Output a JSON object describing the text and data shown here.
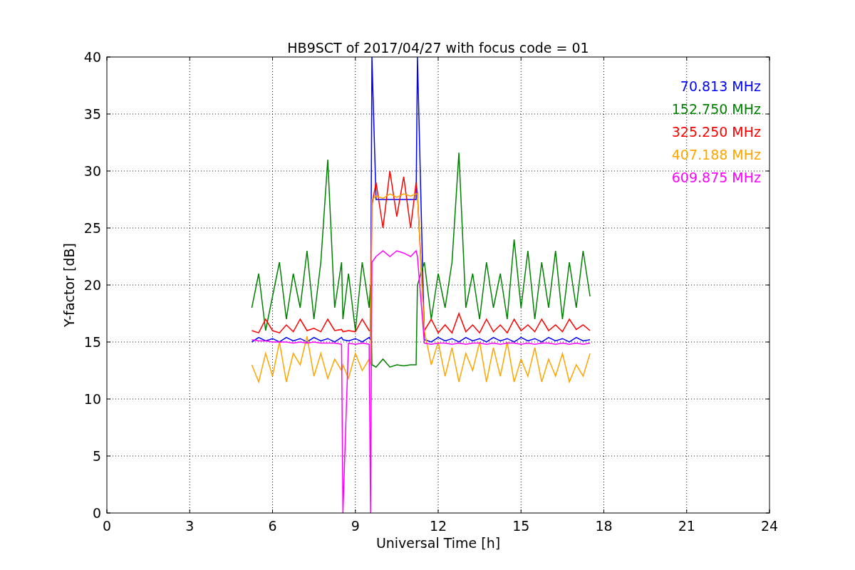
{
  "chart_data": {
    "type": "line",
    "title": "HB9SCT of 2017/04/27 with focus code = 01",
    "xlabel": "Universal Time [h]",
    "ylabel": "Y-factor [dB]",
    "x": [
      5.25,
      5.5,
      5.75,
      6,
      6.25,
      6.5,
      6.75,
      7,
      7.25,
      7.5,
      7.75,
      8,
      8.25,
      8.5,
      8.55,
      8.75,
      9,
      9.25,
      9.5,
      9.55,
      9.6,
      9.75,
      10,
      10.25,
      10.5,
      10.75,
      11,
      11.2,
      11.25,
      11.5,
      11.75,
      12,
      12.25,
      12.5,
      12.75,
      13,
      13.25,
      13.5,
      13.75,
      14,
      14.25,
      14.5,
      14.75,
      15,
      15.25,
      15.5,
      15.75,
      16,
      16.25,
      16.5,
      16.75,
      17,
      17.25,
      17.5
    ],
    "series": [
      {
        "name": "70.813 MHz",
        "color": "#0000ff",
        "values": [
          15.0,
          15.4,
          15.1,
          15.3,
          15.0,
          15.4,
          15.1,
          15.3,
          15.0,
          15.4,
          15.1,
          15.3,
          15.0,
          15.4,
          15.2,
          15.1,
          15.3,
          15.0,
          15.4,
          15.2,
          40,
          27.5,
          27.5,
          27.5,
          27.5,
          27.5,
          27.5,
          27.5,
          40,
          15.2,
          15.0,
          15.4,
          15.1,
          15.3,
          15.0,
          15.4,
          15.1,
          15.3,
          15.0,
          15.4,
          15.1,
          15.3,
          15.0,
          15.4,
          15.1,
          15.3,
          15.0,
          15.4,
          15.1,
          15.3,
          15.0,
          15.4,
          15.1,
          15.2
        ]
      },
      {
        "name": "152.750 MHz",
        "color": "#008000",
        "values": [
          18,
          21,
          16,
          19,
          22,
          17,
          21,
          18,
          23,
          17,
          22,
          31,
          18,
          22,
          17,
          21,
          16,
          22,
          18,
          20,
          13,
          12.8,
          13.5,
          12.8,
          13,
          12.9,
          13,
          13,
          20,
          22,
          17,
          21,
          18,
          22,
          31.6,
          18,
          21,
          17,
          22,
          18,
          21,
          17,
          24,
          18,
          23,
          17,
          22,
          18,
          23,
          17,
          22,
          18,
          23,
          19
        ]
      },
      {
        "name": "325.250 MHz",
        "color": "#ff0000",
        "values": [
          16,
          15.8,
          17,
          16,
          15.8,
          16.5,
          15.9,
          17,
          16,
          16.2,
          15.9,
          17,
          16,
          16.1,
          15.9,
          16,
          15.9,
          17,
          16,
          16,
          27,
          29,
          25,
          30,
          26,
          29.5,
          25,
          29,
          28,
          16,
          17,
          15.8,
          16.5,
          15.8,
          17.5,
          15.9,
          16.5,
          15.8,
          17,
          15.9,
          16.5,
          15.8,
          17,
          16,
          16.5,
          15.9,
          17,
          16,
          16.5,
          15.9,
          17,
          16.1,
          16.5,
          16
        ]
      },
      {
        "name": "407.188 MHz",
        "color": "#ffa500",
        "values": [
          13,
          11.5,
          14,
          12,
          15,
          11.5,
          14,
          13,
          15.5,
          12,
          14,
          11.8,
          13.5,
          12.5,
          13,
          11.8,
          14,
          12.5,
          13.5,
          13,
          27.5,
          27.8,
          27.6,
          28,
          27.7,
          28,
          27.8,
          28,
          28,
          16,
          13,
          15,
          12,
          14.5,
          11.5,
          14,
          12.5,
          15,
          11.5,
          14.5,
          12,
          15,
          11.5,
          13.5,
          12,
          14.5,
          11.5,
          13.5,
          12,
          14,
          11.5,
          13,
          12,
          14
        ]
      },
      {
        "name": "609.875 MHz",
        "color": "#ff00ff",
        "values": [
          15.2,
          15.1,
          15.1,
          15,
          15,
          15,
          14.9,
          15,
          14.9,
          15,
          14.9,
          14.9,
          14.9,
          14.8,
          0,
          14.9,
          14.8,
          14.9,
          14.8,
          0,
          22,
          22.5,
          23,
          22.5,
          23,
          22.8,
          22.5,
          23,
          22.5,
          14.9,
          14.8,
          14.9,
          14.9,
          14.8,
          14.9,
          14.8,
          14.9,
          14.9,
          14.8,
          14.9,
          14.8,
          14.9,
          14.9,
          14.8,
          14.9,
          14.8,
          14.9,
          14.9,
          14.8,
          14.9,
          14.8,
          14.9,
          14.8,
          14.9
        ]
      }
    ],
    "grid": true,
    "xlim": [
      0,
      24
    ],
    "ylim": [
      0,
      40
    ],
    "xticks": [
      0,
      3,
      6,
      9,
      12,
      15,
      18,
      21,
      24
    ],
    "yticks": [
      0,
      5,
      10,
      15,
      20,
      25,
      30,
      35,
      40
    ]
  }
}
